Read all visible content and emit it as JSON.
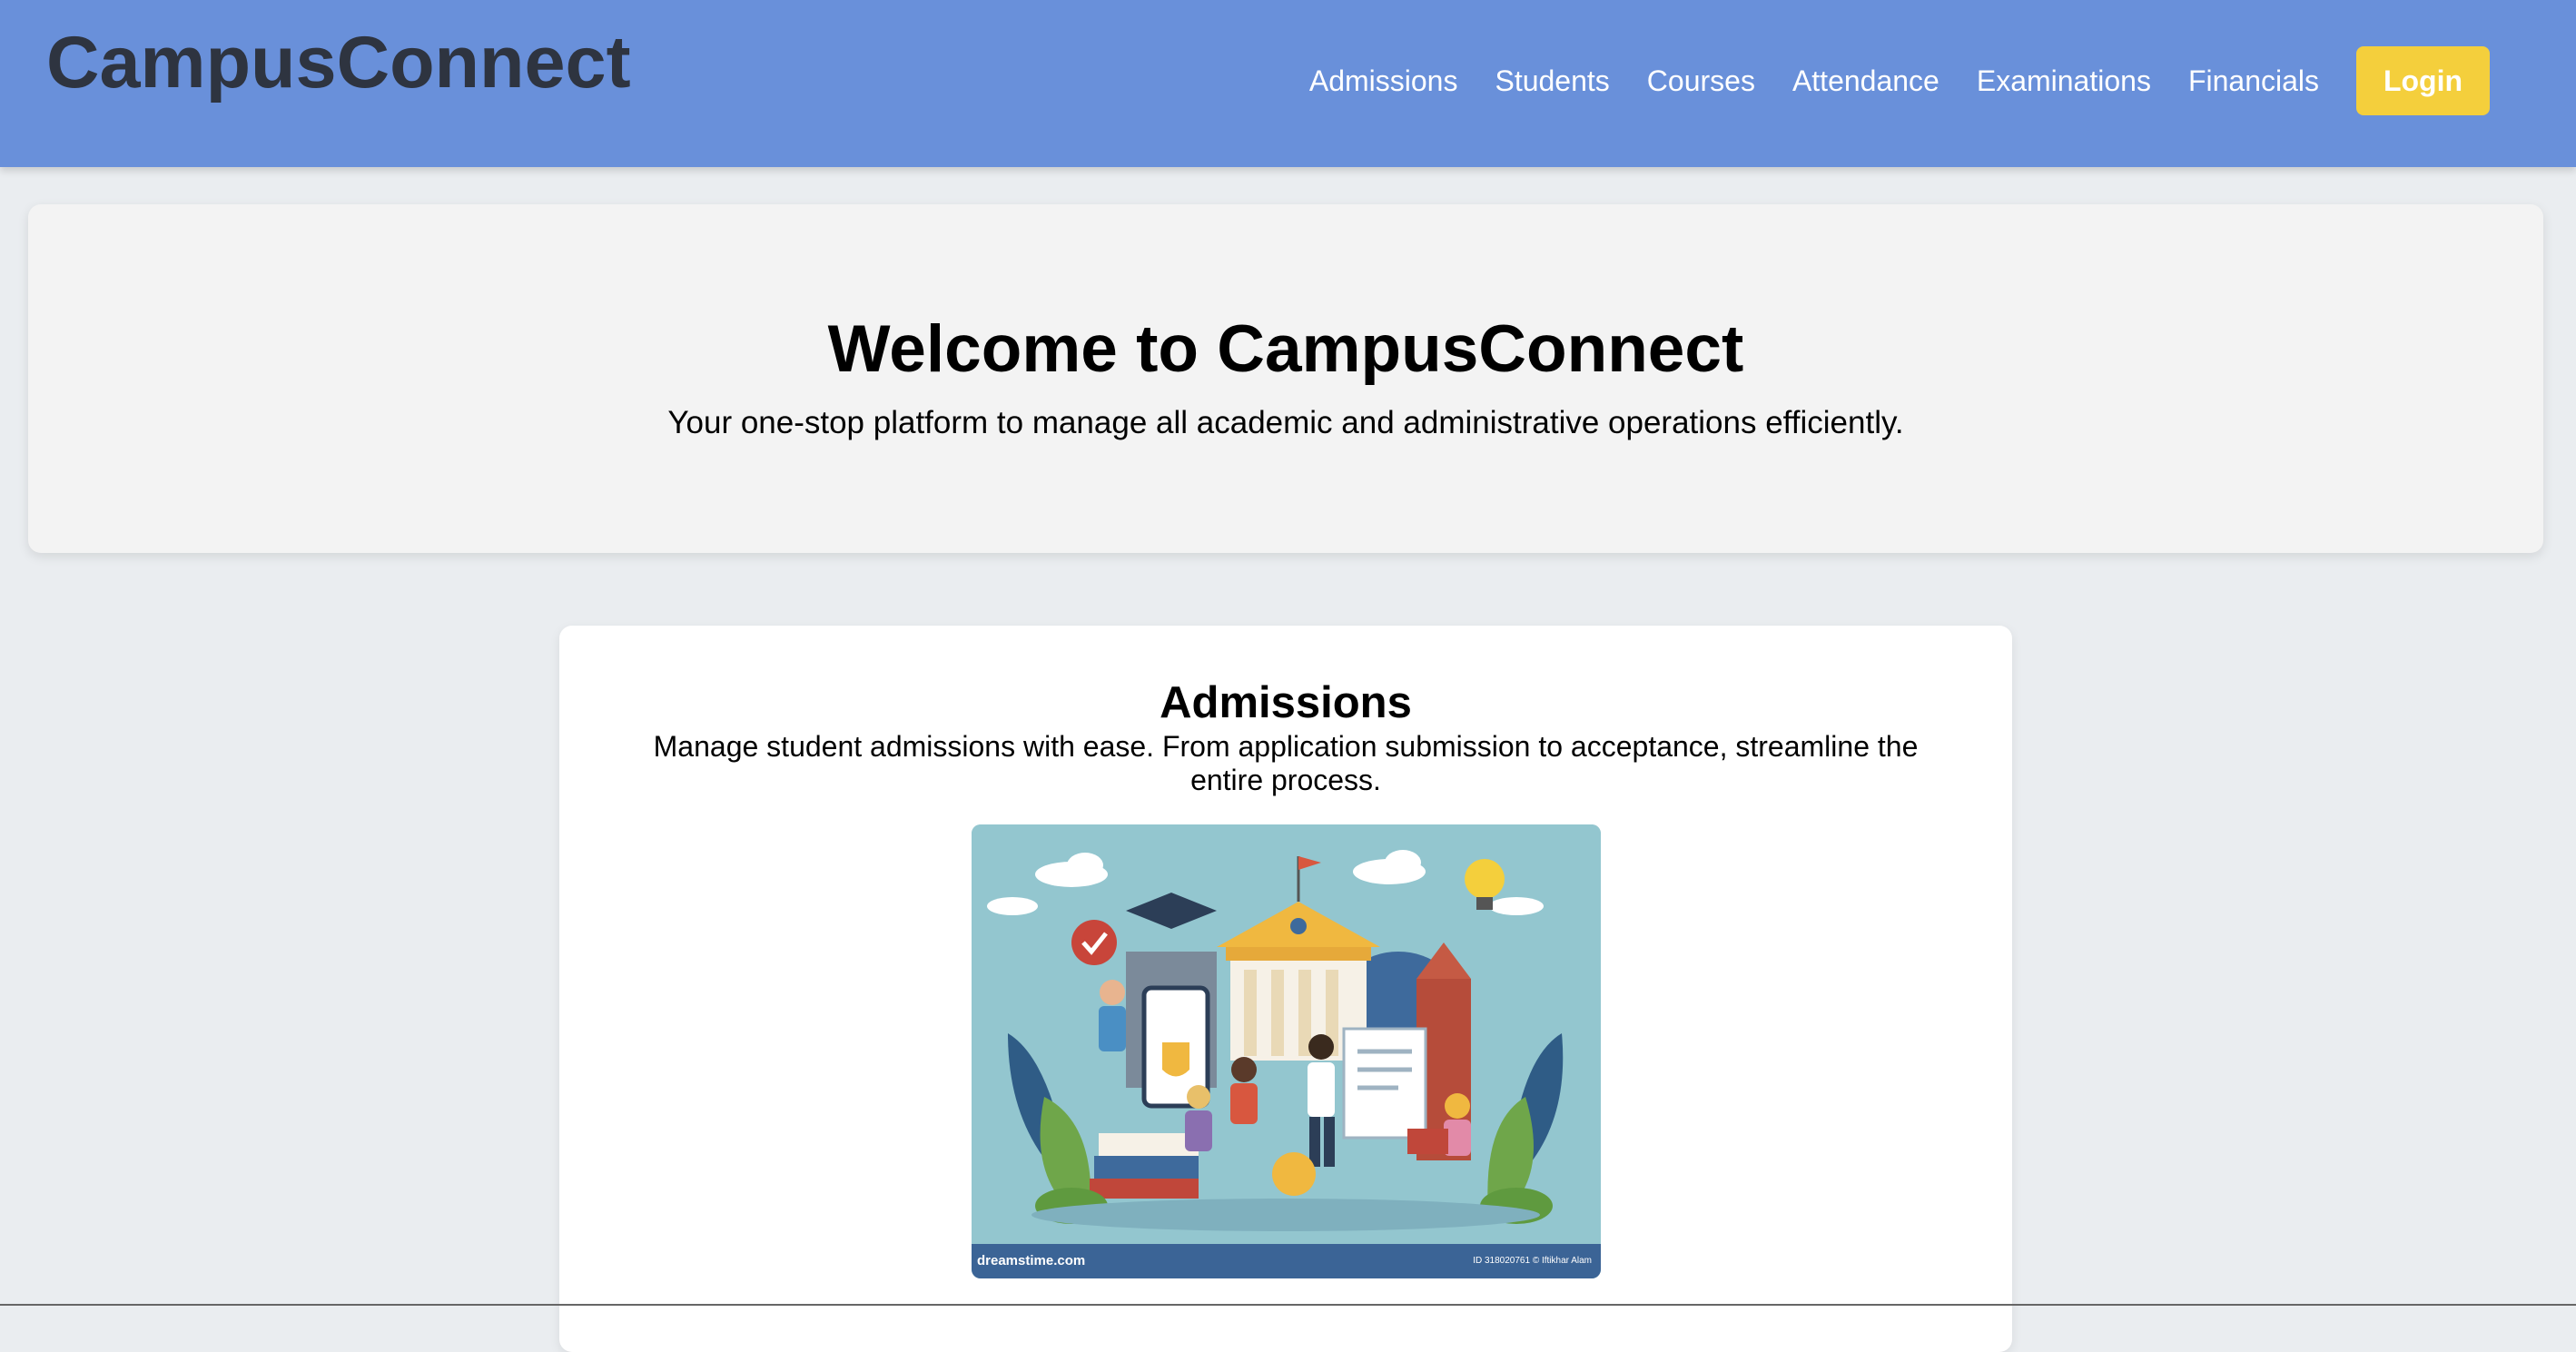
{
  "header": {
    "brand": "CampusConnect",
    "nav": [
      "Admissions",
      "Students",
      "Courses",
      "Attendance",
      "Examinations",
      "Financials"
    ],
    "login_label": "Login"
  },
  "hero": {
    "title": "Welcome to CampusConnect",
    "subtitle": "Your one-stop platform to manage all academic and administrative operations efficiently."
  },
  "admissions_card": {
    "title": "Admissions",
    "description": "Manage student admissions with ease. From application submission to acceptance, streamline the entire process.",
    "image_caption_left": "dreamstime.com",
    "image_caption_right": "ID 318020761 © Iftikhar Alam"
  },
  "colors": {
    "navbar": "#6990da",
    "login_button": "#f4cf3c",
    "page_background": "#eaedf0"
  }
}
